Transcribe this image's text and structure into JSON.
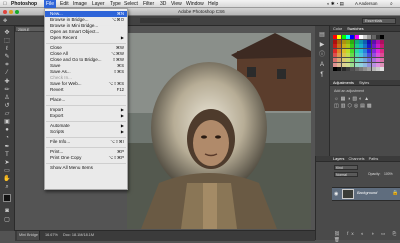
{
  "menubar": {
    "apple": "",
    "app_name": "Photoshop",
    "items": [
      "File",
      "Edit",
      "Image",
      "Layer",
      "Type",
      "Select",
      "Filter",
      "3D",
      "View",
      "Window",
      "Help"
    ],
    "right_user": "A Anderson"
  },
  "window": {
    "title": "Adobe Photoshop CS6",
    "workspace": "Essentials"
  },
  "document": {
    "tab_label": "2509.E",
    "status_text": "16.67%",
    "doc_info": "Doc: 18.1M/18.1M"
  },
  "status_left": "Mini Bridge",
  "file_menu": [
    {
      "label": "New...",
      "shortcut": "⌘N",
      "state": "selected"
    },
    {
      "label": "Browse in Bridge...",
      "shortcut": "⌥⌘O"
    },
    {
      "label": "Browse in Mini Bridge...",
      "shortcut": ""
    },
    {
      "label": "Open as Smart Object...",
      "shortcut": ""
    },
    {
      "label": "Open Recent",
      "shortcut": "",
      "submenu": true
    },
    {
      "sep": true
    },
    {
      "label": "Close",
      "shortcut": "⌘W"
    },
    {
      "label": "Close All",
      "shortcut": "⌥⌘W"
    },
    {
      "label": "Close and Go to Bridge...",
      "shortcut": "⇧⌘W"
    },
    {
      "label": "Save",
      "shortcut": "⌘S"
    },
    {
      "label": "Save As...",
      "shortcut": "⇧⌘S"
    },
    {
      "label": "Check In...",
      "shortcut": "",
      "state": "disabled"
    },
    {
      "label": "Save for Web...",
      "shortcut": "⌥⇧⌘S"
    },
    {
      "label": "Revert",
      "shortcut": "F12"
    },
    {
      "sep": true
    },
    {
      "label": "Place...",
      "shortcut": ""
    },
    {
      "sep": true
    },
    {
      "label": "Import",
      "shortcut": "",
      "submenu": true
    },
    {
      "label": "Export",
      "shortcut": "",
      "submenu": true
    },
    {
      "sep": true
    },
    {
      "label": "Automate",
      "shortcut": "",
      "submenu": true
    },
    {
      "label": "Scripts",
      "shortcut": "",
      "submenu": true
    },
    {
      "sep": true
    },
    {
      "label": "File Info...",
      "shortcut": "⌥⇧⌘I"
    },
    {
      "sep": true
    },
    {
      "label": "Print...",
      "shortcut": "⌘P"
    },
    {
      "label": "Print One Copy",
      "shortcut": "⌥⇧⌘P"
    },
    {
      "sep": true
    },
    {
      "label": "Show All Menu Items",
      "shortcut": ""
    }
  ],
  "panels": {
    "color_tab": "Color",
    "swatches_tab": "Swatches",
    "adjustments_tab": "Adjustments",
    "styles_tab": "Styles",
    "add_adjustment": "Add an adjustment",
    "layers_tab": "Layers",
    "channels_tab": "Channels",
    "paths_tab": "Paths",
    "blend_mode": "Normal",
    "opacity_label": "Opacity:",
    "opacity_value": "100%",
    "layer_name": "Background"
  },
  "colors": {
    "menu_highlight": "#2e64d8",
    "panel_bg": "#4a4a4a",
    "app_bg": "#535353"
  }
}
